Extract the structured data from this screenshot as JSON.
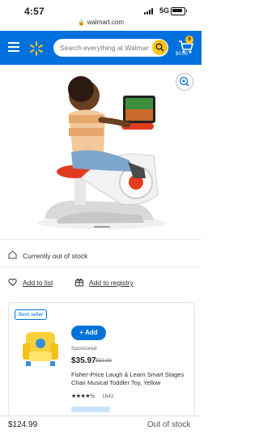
{
  "status_bar": {
    "time": "4:57",
    "network": "5G"
  },
  "browser": {
    "url": "walmart.com"
  },
  "header": {
    "search": {
      "placeholder": "Search everything at Walmart online and in store"
    },
    "cart": {
      "count": "0",
      "total": "$0.00"
    }
  },
  "product": {
    "image_alt": "Child riding a red and white stationary toy bike with a tablet on the handlebars",
    "stock_status": "Currently out of stock",
    "add_to_list": "Add to list",
    "add_to_registry": "Add to registry"
  },
  "sponsored_card": {
    "badge": "Best seller",
    "add_label": "+ Add",
    "sponsored_label": "Sponsored",
    "price": "$35.97",
    "was_price": "$59.99",
    "title": "Fisher-Price Laugh & Learn Smart Stages Chair Musical Toddler Toy, Yellow",
    "rating_stars": "★★★★½",
    "rating_count": "1642"
  },
  "footer": {
    "price": "$124.99",
    "status": "Out of stock"
  },
  "colors": {
    "brand_blue": "#0071dc",
    "brand_yellow": "#ffc220"
  }
}
